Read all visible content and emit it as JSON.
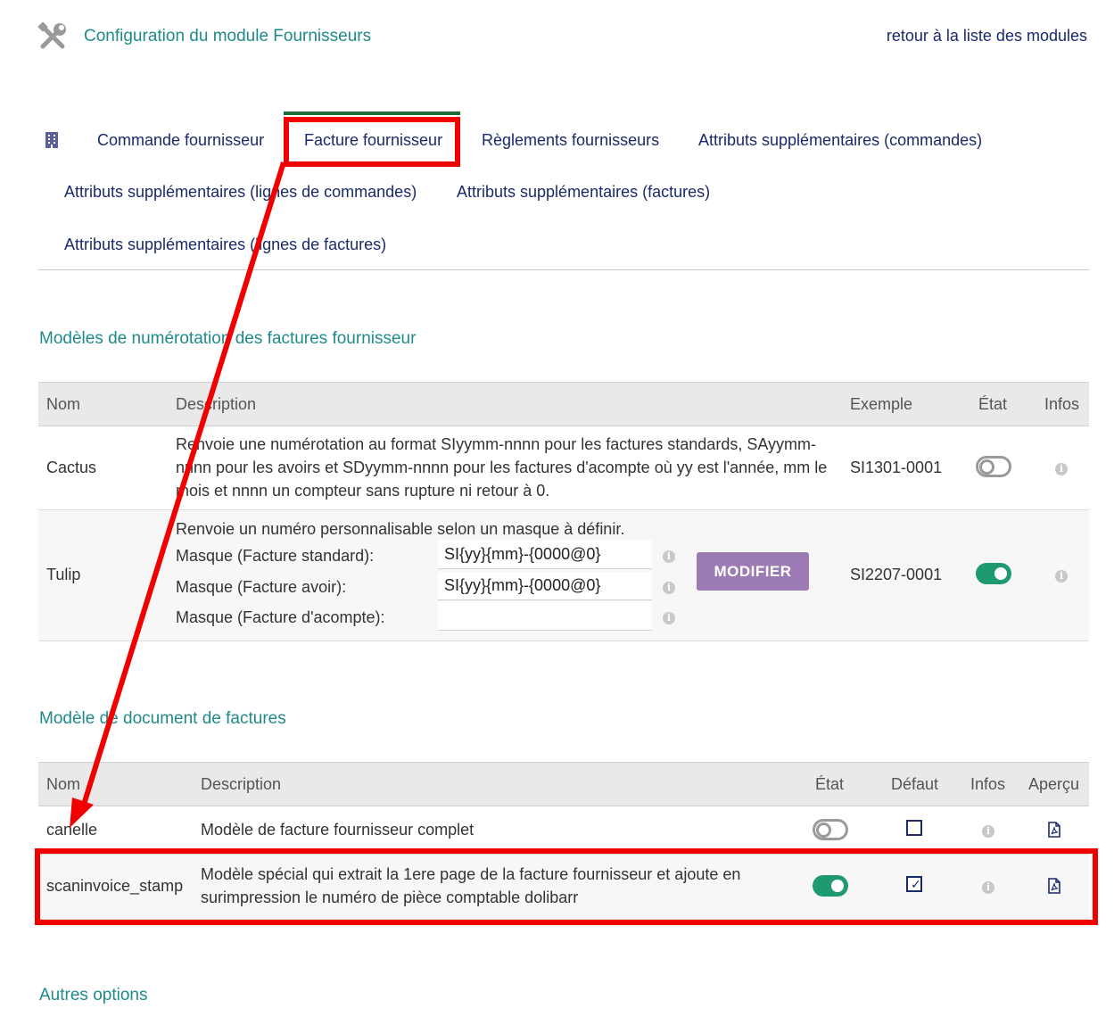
{
  "header": {
    "title": "Configuration du module Fournisseurs",
    "back_link": "retour à la liste des modules"
  },
  "tabs": [
    {
      "label": "Commande fournisseur"
    },
    {
      "label": "Facture fournisseur",
      "active": true
    },
    {
      "label": "Règlements fournisseurs"
    },
    {
      "label": "Attributs supplémentaires (commandes)"
    },
    {
      "label": "Attributs supplémentaires (lignes de commandes)"
    },
    {
      "label": "Attributs supplémentaires (factures)"
    },
    {
      "label": "Attributs supplémentaires (lignes de factures)"
    }
  ],
  "numbering": {
    "title": "Modèles de numérotation des factures fournisseur",
    "headers": {
      "name": "Nom",
      "description": "Description",
      "example": "Exemple",
      "state": "État",
      "infos": "Infos"
    },
    "rows": [
      {
        "name": "Cactus",
        "description_lines": [
          "Renvoie une numérotation au format SIyymm-nnnn pour les factures standards, SAyymm-",
          "nnnn pour les avoirs et SDyymm-nnnn pour les factures d'acompte où yy est l'année, mm le",
          "mois et nnnn un compteur sans rupture ni retour à 0."
        ],
        "example": "SI1301-0001",
        "state": "off"
      },
      {
        "name": "Tulip",
        "description": "Renvoie un numéro personnalisable selon un masque à définir.",
        "masks": [
          {
            "label": "Masque (Facture standard):",
            "value": "SI{yy}{mm}-{0000@0}"
          },
          {
            "label": "Masque (Facture avoir):",
            "value": "SI{yy}{mm}-{0000@0}"
          },
          {
            "label": "Masque (Facture d'acompte):",
            "value": ""
          }
        ],
        "button": "MODIFIER",
        "example": "SI2207-0001",
        "state": "on"
      }
    ]
  },
  "documents": {
    "title": "Modèle de document de factures",
    "headers": {
      "name": "Nom",
      "description": "Description",
      "state": "État",
      "default": "Défaut",
      "infos": "Infos",
      "preview": "Aperçu"
    },
    "rows": [
      {
        "name": "canelle",
        "description_lines": [
          "Modèle de facture fournisseur complet"
        ],
        "state": "off",
        "default": false
      },
      {
        "name": "scaninvoice_stamp",
        "description_lines": [
          "Modèle spécial qui extrait la 1ere page de la facture fournisseur et ajoute en",
          "surimpression le numéro de pièce comptable dolibarr"
        ],
        "state": "on",
        "default": true
      }
    ]
  },
  "other": {
    "title": "Autres options"
  },
  "colors": {
    "accent_teal": "#1f8a8a",
    "link_navy": "#1a2a6b",
    "toggle_on": "#1f9a6e",
    "button_purple": "#9c7bb5",
    "annotation_red": "#f00000"
  }
}
